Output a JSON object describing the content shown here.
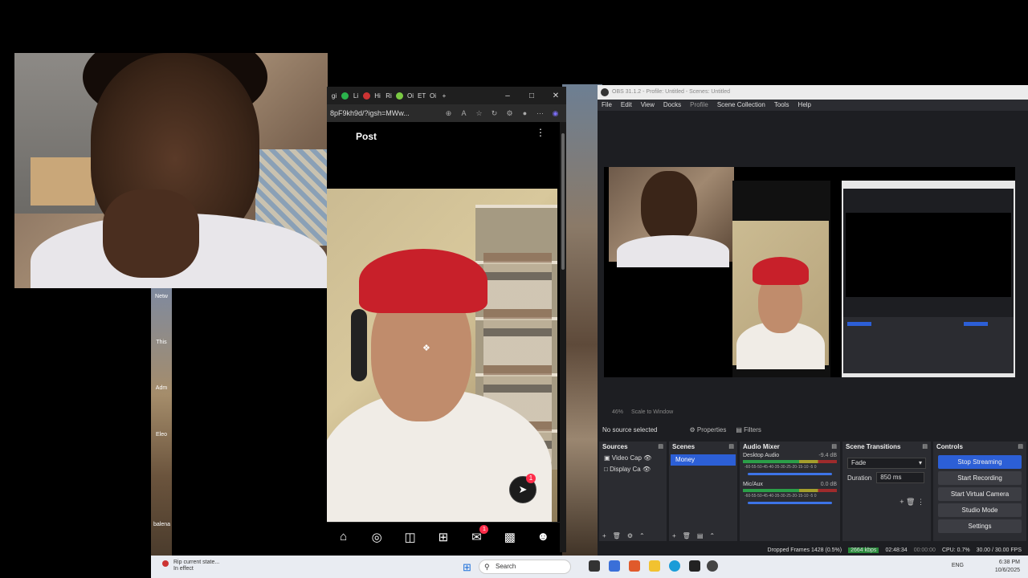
{
  "browser": {
    "tab_labels": [
      "gi",
      "Li",
      "Hi",
      "Ri",
      "Oi",
      "ET",
      "Oi"
    ],
    "new_tab": "+",
    "url": "8pF9kh9d/?igsh=MWw...",
    "post_title": "Post",
    "more": "⋮",
    "dm_badge": "1",
    "nav_badge": "1",
    "nav_icons": [
      "home-icon",
      "explore-icon",
      "reels-icon",
      "create-icon",
      "messages-icon",
      "insights-icon",
      "profile-icon"
    ]
  },
  "obs": {
    "title": "OBS 31.1.2 - Profile: Untitled - Scenes: Untitled",
    "menu": [
      "File",
      "Edit",
      "View",
      "Docks",
      "Profile",
      "Scene Collection",
      "Tools",
      "Help"
    ],
    "zoom": "46%",
    "scale_mode": "Scale to Window",
    "no_source": "No source selected",
    "properties": "Properties",
    "filters": "Filters",
    "docks": {
      "sources": "Sources",
      "scenes": "Scenes",
      "audio_mixer": "Audio Mixer",
      "scene_transitions": "Scene Transitions",
      "controls": "Controls"
    },
    "sources": [
      "Video Cap",
      "Display Ca"
    ],
    "scenes": [
      "Money"
    ],
    "mixer": [
      {
        "name": "Desktop Audio",
        "db": "-9.4 dB"
      },
      {
        "name": "Mic/Aux",
        "db": "0.0 dB"
      }
    ],
    "meter_scale": "-60-55-50-45-40-35-30-25-20-15-10 -5 0",
    "transition": "Fade",
    "duration_label": "Duration",
    "duration_value": "850 ms",
    "controls": [
      "Stop Streaming",
      "Start Recording",
      "Start Virtual Camera",
      "Studio Mode",
      "Settings"
    ],
    "status": {
      "dropped": "Dropped Frames 1428 (0.5%)",
      "bitrate": "2664 kbps",
      "stream_time": "02:48:34",
      "rec_time": "00:00:00",
      "cpu": "CPU: 0.7%",
      "fps": "30.00 / 30.00 FPS"
    }
  },
  "taskbar": {
    "note_line1": "Rip current state...",
    "note_line2": "In effect",
    "search": "Search",
    "lang": "ENG",
    "time": "6:38 PM",
    "date": "10/6/2025"
  },
  "desktop": {
    "icon_labels": [
      "Netw",
      "This",
      "Adm",
      "Eleo",
      "balena"
    ]
  }
}
